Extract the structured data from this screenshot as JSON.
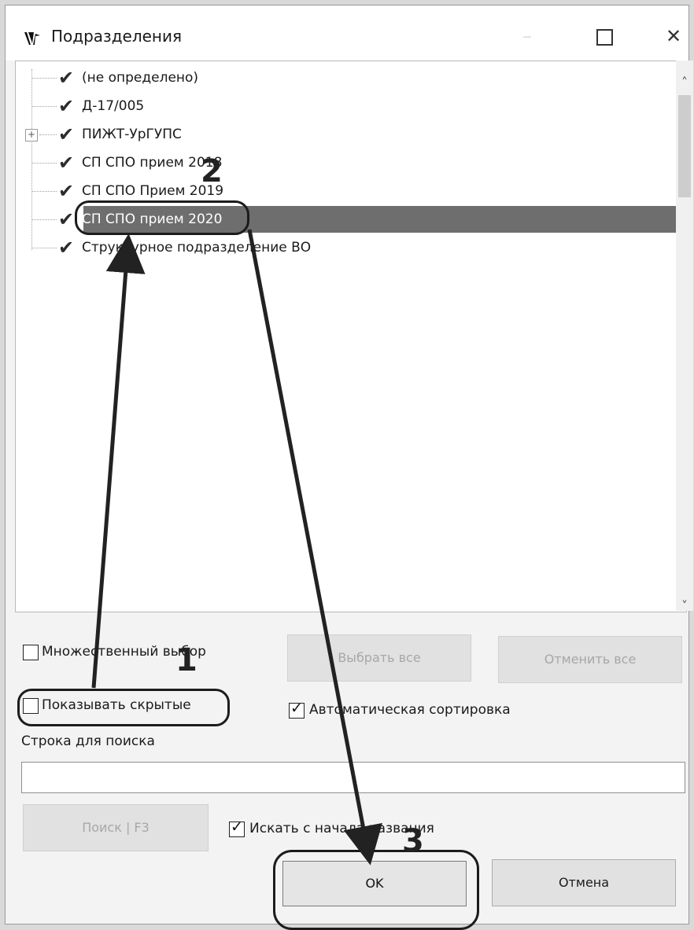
{
  "window": {
    "title": "Подразделения",
    "icon": "app-logo-icon",
    "controls": {
      "minimize": "–",
      "maximize": "",
      "close": "✕"
    }
  },
  "tree": {
    "items": [
      {
        "label": "(не определено)",
        "checked": true,
        "expandable": false,
        "selected": false
      },
      {
        "label": "Д-17/005",
        "checked": true,
        "expandable": false,
        "selected": false
      },
      {
        "label": "ПИЖТ-УрГУПС",
        "checked": true,
        "expandable": true,
        "selected": false
      },
      {
        "label": "СП СПО прием 2018",
        "checked": true,
        "expandable": false,
        "selected": false
      },
      {
        "label": "СП СПО Прием 2019",
        "checked": true,
        "expandable": false,
        "selected": false
      },
      {
        "label": "СП СПО прием 2020",
        "checked": true,
        "expandable": false,
        "selected": true
      },
      {
        "label": "Структурное подразделение ВО",
        "checked": true,
        "expandable": false,
        "selected": false
      }
    ],
    "check_glyph": "✔",
    "expander_glyph": "+"
  },
  "scrollbar": {
    "up": "˄",
    "down": "˅"
  },
  "options": {
    "multi_select_label": "Множественный выбор",
    "multi_select_checked": false,
    "select_all_label": "Выбрать все",
    "cancel_all_label": "Отменить все",
    "show_hidden_label": "Показывать скрытые",
    "show_hidden_checked": false,
    "auto_sort_label": "Автоматическая сортировка",
    "auto_sort_checked": true
  },
  "search": {
    "label": "Строка для поиска",
    "value": "",
    "button_label": "Поиск | F3",
    "from_start_label": "Искать с начала названия",
    "from_start_checked": true
  },
  "footer": {
    "ok_label": "OK",
    "cancel_label": "Отмена"
  },
  "annotations": {
    "step1": "1",
    "step2": "2",
    "step3": "3"
  }
}
